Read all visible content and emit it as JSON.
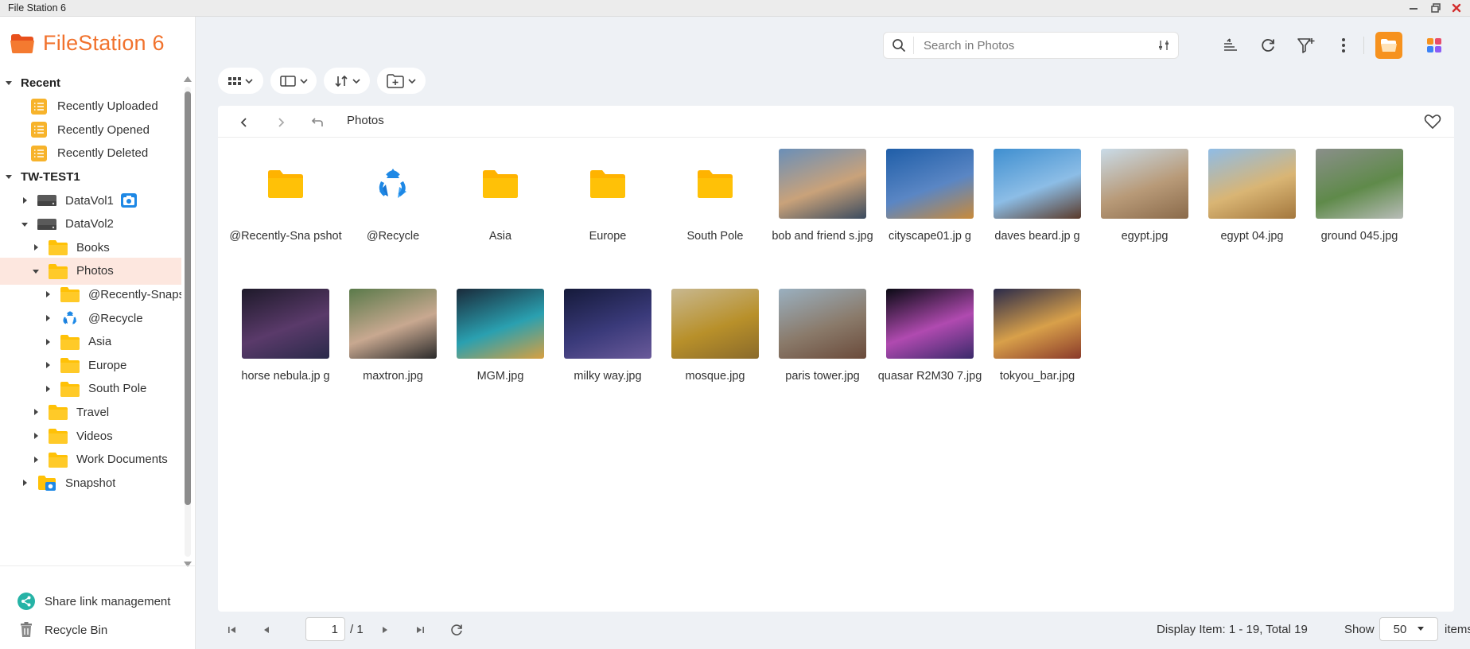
{
  "window": {
    "title": "File Station 6"
  },
  "app": {
    "name": "FileStation 6"
  },
  "tree": [
    {
      "label": "Recent",
      "level": 0,
      "kind": "header",
      "expanded": true
    },
    {
      "label": "Recently Uploaded",
      "level": 1,
      "kind": "recent"
    },
    {
      "label": "Recently Opened",
      "level": 1,
      "kind": "recent"
    },
    {
      "label": "Recently Deleted",
      "level": 1,
      "kind": "recent"
    },
    {
      "label": "TW-TEST1",
      "level": 0,
      "kind": "header",
      "expanded": true
    },
    {
      "label": "DataVol1",
      "level": 1,
      "kind": "drive",
      "badge": "camera",
      "collapsed": true
    },
    {
      "label": "DataVol2",
      "level": 1,
      "kind": "drive",
      "expanded": true
    },
    {
      "label": "Books",
      "level": 2,
      "kind": "folder",
      "collapsed": true
    },
    {
      "label": "Photos",
      "level": 2,
      "kind": "folder",
      "expanded": true,
      "selected": true
    },
    {
      "label": "@Recently-Snapshot",
      "level": 3,
      "kind": "folder",
      "collapsed": true
    },
    {
      "label": "@Recycle",
      "level": 3,
      "kind": "recycle",
      "collapsed": true
    },
    {
      "label": "Asia",
      "level": 3,
      "kind": "folder",
      "collapsed": true
    },
    {
      "label": "Europe",
      "level": 3,
      "kind": "folder",
      "collapsed": true
    },
    {
      "label": "South Pole",
      "level": 3,
      "kind": "folder",
      "collapsed": true
    },
    {
      "label": "Travel",
      "level": 2,
      "kind": "folder",
      "collapsed": true
    },
    {
      "label": "Videos",
      "level": 2,
      "kind": "folder",
      "collapsed": true
    },
    {
      "label": "Work Documents",
      "level": 2,
      "kind": "folder",
      "collapsed": true
    },
    {
      "label": "Snapshot",
      "level": 1,
      "kind": "snapshot",
      "collapsed": true
    }
  ],
  "sidebar_bottom": {
    "share_link": "Share link management",
    "recycle_bin": "Recycle Bin"
  },
  "search": {
    "placeholder": "Search in Photos",
    "value": ""
  },
  "breadcrumb": {
    "current": "Photos"
  },
  "files": [
    {
      "name": "@Recently-Snapshot",
      "display": "@Recently-Sna pshot",
      "type": "folder"
    },
    {
      "name": "@Recycle",
      "display": "@Recycle",
      "type": "recycle"
    },
    {
      "name": "Asia",
      "display": "Asia",
      "type": "folder"
    },
    {
      "name": "Europe",
      "display": "Europe",
      "type": "folder"
    },
    {
      "name": "South Pole",
      "display": "South Pole",
      "type": "folder"
    },
    {
      "name": "bob and friends.jpg",
      "display": "bob and friend s.jpg",
      "type": "image",
      "colors": [
        "#6a8fb8",
        "#c9a27a",
        "#3a4a5e"
      ]
    },
    {
      "name": "cityscape01.jpg",
      "display": "cityscape01.jp g",
      "type": "image",
      "colors": [
        "#1f5ea8",
        "#5a86c4",
        "#c98a3a"
      ]
    },
    {
      "name": "daves beard.jpg",
      "display": "daves beard.jp g",
      "type": "image",
      "colors": [
        "#3f8fd0",
        "#8cbde6",
        "#5a3a2a"
      ]
    },
    {
      "name": "egypt.jpg",
      "display": "egypt.jpg",
      "type": "image",
      "colors": [
        "#c9dbe8",
        "#b89a78",
        "#8a6a4a"
      ]
    },
    {
      "name": "egypt 04.jpg",
      "display": "egypt 04.jpg",
      "type": "image",
      "colors": [
        "#8fbce6",
        "#d9b574",
        "#a3773d"
      ]
    },
    {
      "name": "ground 045.jpg",
      "display": "ground 045.jpg",
      "type": "image",
      "colors": [
        "#8a8f8a",
        "#5f8a4a",
        "#b8bcb8"
      ]
    },
    {
      "name": "horse nebula.jpg",
      "display": "horse nebula.jp g",
      "type": "image",
      "colors": [
        "#1e1a2a",
        "#5a3a6a",
        "#2a2a4a"
      ]
    },
    {
      "name": "maxtron.jpg",
      "display": "maxtron.jpg",
      "type": "image",
      "colors": [
        "#5a7a4a",
        "#c8a890",
        "#2a2a2a"
      ]
    },
    {
      "name": "MGM.jpg",
      "display": "MGM.jpg",
      "type": "image",
      "colors": [
        "#1a2a3a",
        "#2aa0b0",
        "#d8a040"
      ]
    },
    {
      "name": "milky way.jpg",
      "display": "milky way.jpg",
      "type": "image",
      "colors": [
        "#151a3a",
        "#3a3a7a",
        "#6a5a9a"
      ]
    },
    {
      "name": "mosque.jpg",
      "display": "mosque.jpg",
      "type": "image",
      "colors": [
        "#c8b890",
        "#b8902a",
        "#8a6a2a"
      ]
    },
    {
      "name": "paris tower.jpg",
      "display": "paris tower.jpg",
      "type": "image",
      "colors": [
        "#9ab0c0",
        "#8a7a6a",
        "#6a4a3a"
      ]
    },
    {
      "name": "quasar R2M307.jpg",
      "display": "quasar R2M30 7.jpg",
      "type": "image",
      "colors": [
        "#0a0a14",
        "#b04ab0",
        "#3a2a6a"
      ]
    },
    {
      "name": "tokyou_bar.jpg",
      "display": "tokyou_bar.jpg",
      "type": "image",
      "colors": [
        "#2a2a4a",
        "#d8a04a",
        "#8a3a2a"
      ]
    }
  ],
  "pager": {
    "page": "1",
    "total_pages": "/ 1",
    "display": "Display Item: 1 - 19, Total 19",
    "show_label": "Show",
    "per_page": "50",
    "items_label": "items"
  },
  "colors": {
    "accent": "#f1722d",
    "folder": "#ffc107",
    "selected_bg": "#fde7df",
    "app_button": "#f6921e"
  }
}
